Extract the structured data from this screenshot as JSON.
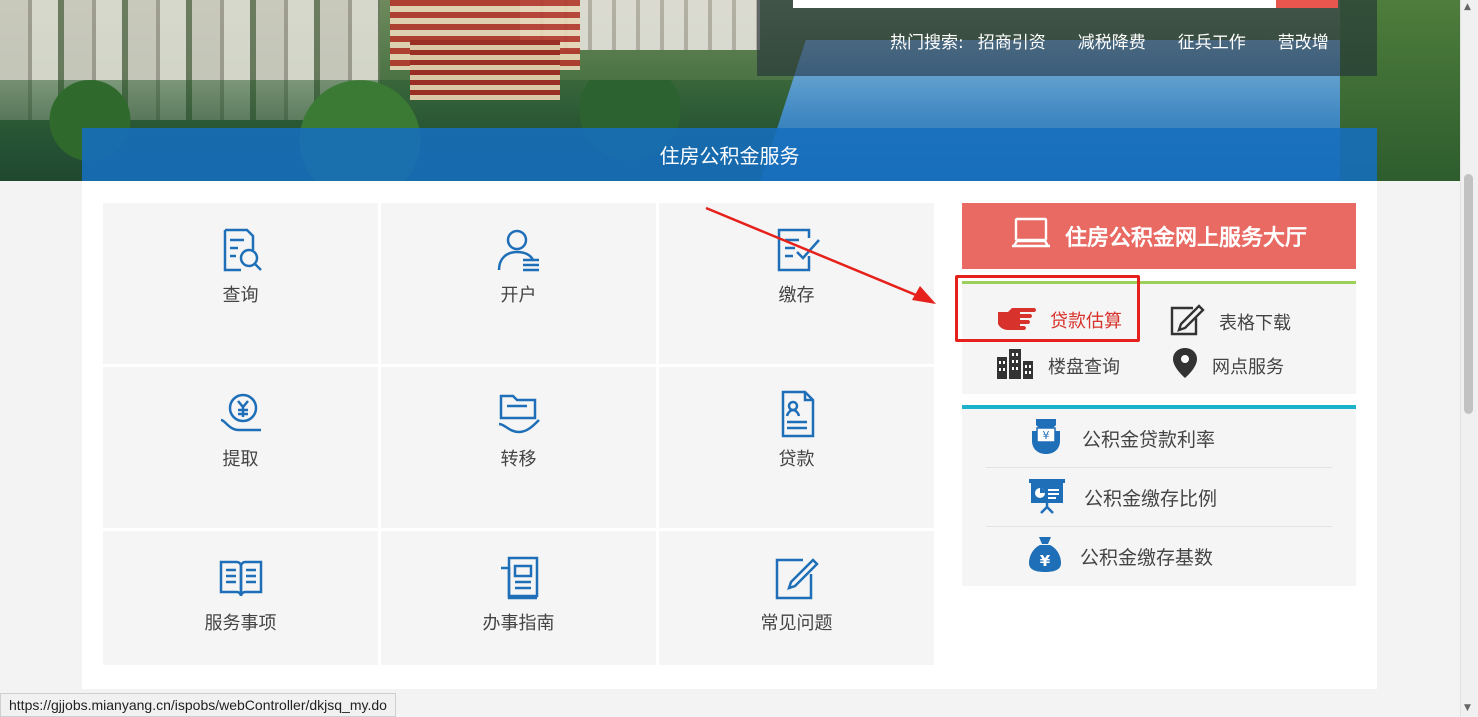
{
  "hot_search": {
    "label": "热门搜索:",
    "keywords": [
      "招商引资",
      "减税降费",
      "征兵工作",
      "营改增"
    ]
  },
  "band_title": "住房公积金服务",
  "tiles": [
    {
      "label": "查询",
      "icon": "search-doc-icon"
    },
    {
      "label": "开户",
      "icon": "user-list-icon"
    },
    {
      "label": "缴存",
      "icon": "doc-check-icon"
    },
    {
      "label": "提取",
      "icon": "yuan-hand-icon"
    },
    {
      "label": "转移",
      "icon": "folder-hand-icon"
    },
    {
      "label": "贷款",
      "icon": "contract-icon"
    },
    {
      "label": "服务事项",
      "icon": "book-icon"
    },
    {
      "label": "办事指南",
      "icon": "guide-icon"
    },
    {
      "label": "常见问题",
      "icon": "edit-icon"
    }
  ],
  "hall": {
    "label": "住房公积金网上服务大厅",
    "icon": "laptop-icon"
  },
  "quick_links": [
    {
      "label": "贷款估算",
      "icon": "pointing-hand-icon",
      "active": true
    },
    {
      "label": "表格下载",
      "icon": "edit-form-icon"
    },
    {
      "label": "楼盘查询",
      "icon": "buildings-icon"
    },
    {
      "label": "网点服务",
      "icon": "location-pin-icon"
    }
  ],
  "rate_links": [
    {
      "label": "公积金贷款利率",
      "icon": "yuan-bag-icon"
    },
    {
      "label": "公积金缴存比例",
      "icon": "presentation-icon"
    },
    {
      "label": "公积金缴存基数",
      "icon": "money-bag-icon"
    }
  ],
  "status_url": "https://gjjobs.mianyang.cn/ispobs/webController/dkjsq_my.do",
  "colors": {
    "accent_red": "#e86a63",
    "band_blue": "#166ebe",
    "icon_blue": "#1f6fb8",
    "highlight_red": "#e6211b"
  }
}
